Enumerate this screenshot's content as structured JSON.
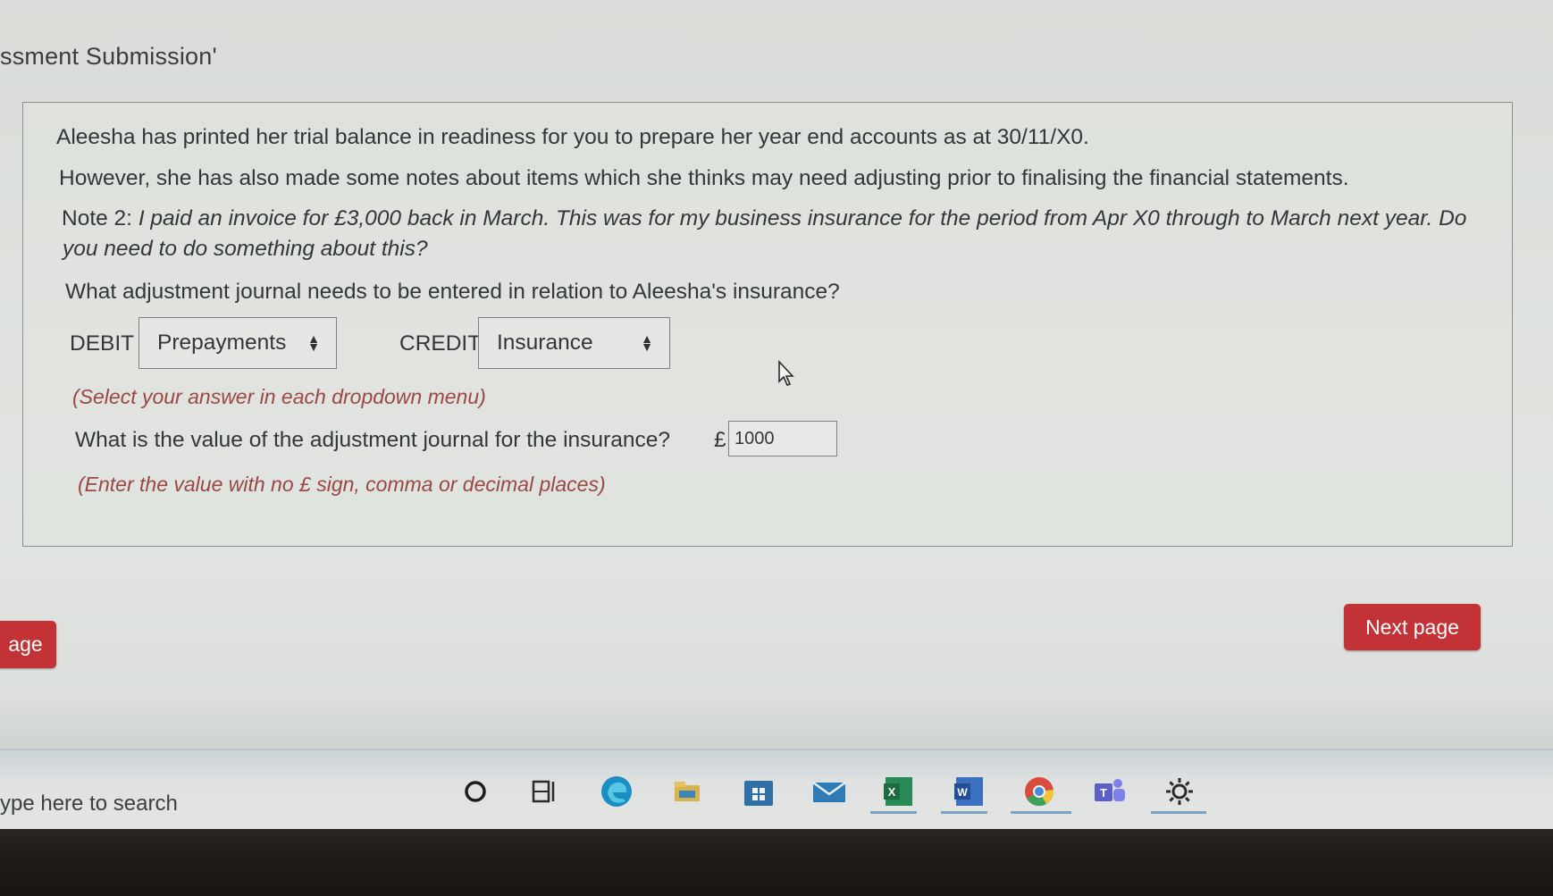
{
  "header": {
    "title": "ssment Submission'"
  },
  "question": {
    "intro": "Aleesha has printed her trial balance in readiness for you to prepare her year end accounts as at 30/11/X0.",
    "notes_line": "However, she has also made some notes about items which she thinks may need adjusting prior to finalising the financial statements.",
    "note_label": "Note 2:",
    "note_text_1": "I paid an invoice for £3,000 back in March.  This was for my business insurance for the period from Apr X0 through to March next year.  Do",
    "note_text_2": "you need to do something about this?",
    "prompt": "What adjustment journal needs to be entered in relation to Aleesha's insurance?",
    "debit_label": "DEBIT",
    "debit_value": "Prepayments",
    "credit_label": "CREDIT",
    "credit_value": "Insurance",
    "select_hint": "(Select your answer in each dropdown menu)",
    "value_prompt": "What is the value of the adjustment journal for the insurance?",
    "currency_symbol": "£",
    "value": "1000",
    "value_hint": "(Enter the value with no £ sign, comma or decimal places)"
  },
  "nav": {
    "prev_label": "age",
    "next_label": "Next page"
  },
  "taskbar": {
    "search_placeholder": "ype here to search",
    "icons": [
      "cortana-icon",
      "task-view-icon",
      "edge-icon",
      "file-explorer-icon",
      "store-icon",
      "mail-icon",
      "excel-icon",
      "word-icon",
      "chrome-icon",
      "teams-icon",
      "settings-icon"
    ]
  },
  "colors": {
    "accent_button": "#c23236",
    "hint_text": "#9a4846",
    "taskbar_highlight": "#4b87b8"
  }
}
